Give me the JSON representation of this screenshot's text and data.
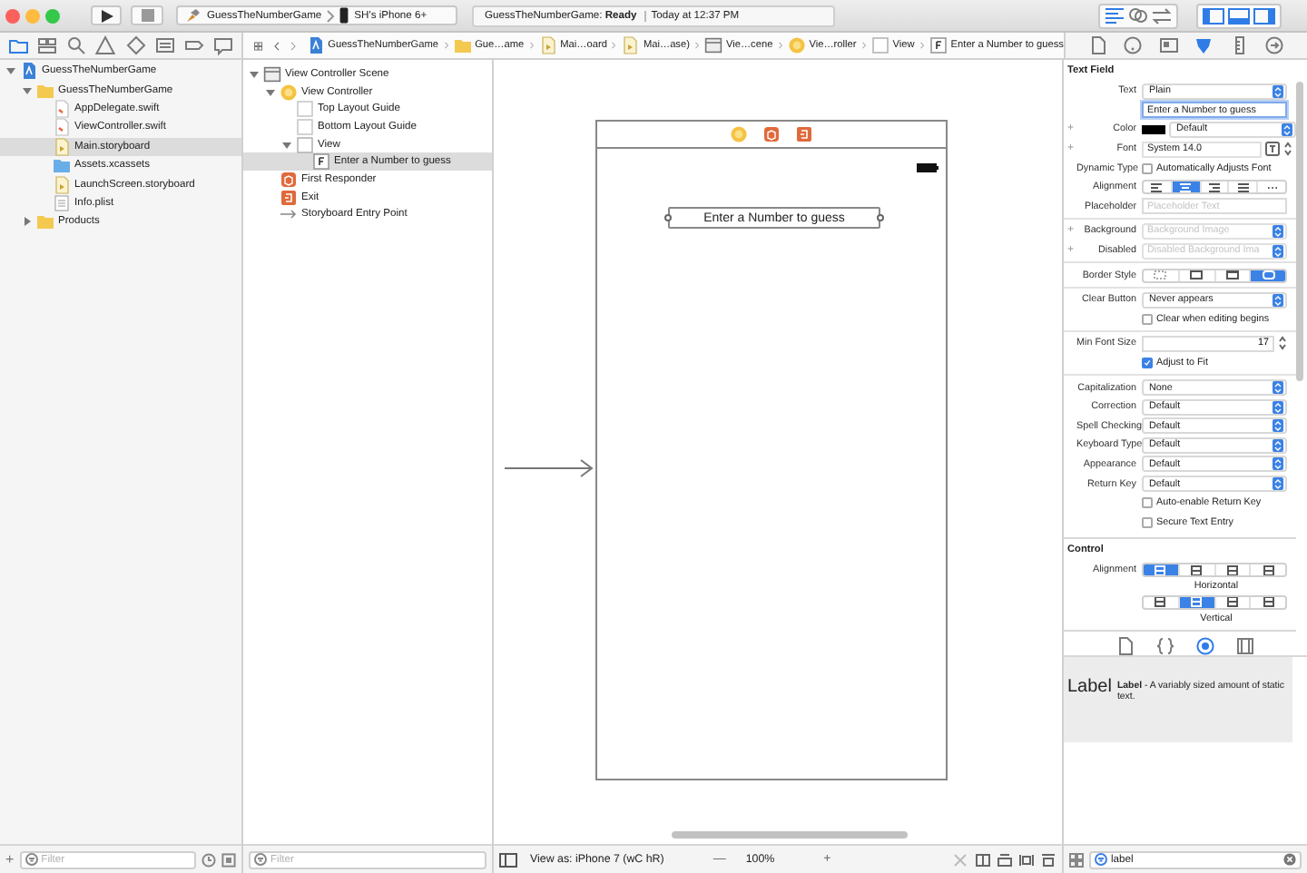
{
  "window": {
    "controls": [
      {
        "color": "#fc605c"
      },
      {
        "color": "#fdbc40"
      },
      {
        "color": "#34c84a"
      }
    ]
  },
  "toolbar": {
    "scheme": "GuessTheNumberGame",
    "device": "SH's iPhone 6+",
    "activity": "GuessTheNumberGame: **Ready**",
    "time": "Today at 12:37 PM",
    "editor_modes": [
      {
        "kind": "standard",
        "selected": true
      },
      {
        "kind": "assistant",
        "selected": false
      },
      {
        "kind": "version",
        "selected": false
      }
    ],
    "panels": [
      {
        "kind": "navigator",
        "on": true
      },
      {
        "kind": "debug",
        "on": true
      },
      {
        "kind": "utilities",
        "on": true
      }
    ]
  },
  "navigator": {
    "tabs": [
      {
        "kind": "folder",
        "selected": true
      },
      {
        "kind": "hierarchy",
        "selected": false
      },
      {
        "kind": "search",
        "selected": false
      },
      {
        "kind": "warning",
        "selected": false
      },
      {
        "kind": "test",
        "selected": false
      },
      {
        "kind": "debug",
        "selected": false
      },
      {
        "kind": "breakpoint",
        "selected": false
      },
      {
        "kind": "report",
        "selected": false
      }
    ],
    "tree": [
      {
        "label": "GuessTheNumberGame",
        "kind": "project",
        "expanded": true,
        "selected": false,
        "children": [
          {
            "label": "GuessTheNumberGame",
            "kind": "folder",
            "expanded": true,
            "selected": false,
            "children": [
              {
                "label": "AppDelegate.swift",
                "kind": "swift",
                "selected": false
              },
              {
                "label": "ViewController.swift",
                "kind": "swift",
                "selected": false
              },
              {
                "label": "Main.storyboard",
                "kind": "storyboard",
                "selected": true
              },
              {
                "label": "Assets.xcassets",
                "kind": "assets",
                "selected": false
              },
              {
                "label": "LaunchScreen.storyboard",
                "kind": "storyboard",
                "selected": false
              },
              {
                "label": "Info.plist",
                "kind": "plist",
                "selected": false
              }
            ]
          },
          {
            "label": "Products",
            "kind": "folder",
            "expanded": false,
            "selected": false
          }
        ]
      }
    ],
    "add": "+",
    "filter": {
      "placeholder": "Filter"
    }
  },
  "jump_bar": {
    "crumbs": [
      {
        "label": "GuessTheNumberGame",
        "kind": "project"
      },
      {
        "label": "Gue…ame",
        "kind": "folder"
      },
      {
        "label": "Mai…oard",
        "kind": "storyboard"
      },
      {
        "label": "Mai…ase)",
        "kind": "storyboard"
      },
      {
        "label": "Vie…cene",
        "kind": "scene"
      },
      {
        "label": "Vie…roller",
        "kind": "controller"
      },
      {
        "label": "View",
        "kind": "view"
      },
      {
        "label": "Enter a Number to guess",
        "kind": "textfield"
      }
    ]
  },
  "outline": {
    "tree": [
      {
        "label": "View Controller Scene",
        "kind": "scene",
        "expanded": true,
        "selected": false,
        "children": [
          {
            "label": "View Controller",
            "kind": "controller",
            "expanded": true,
            "selected": false,
            "children": [
              {
                "label": "Top Layout Guide",
                "kind": "guide",
                "selected": false
              },
              {
                "label": "Bottom Layout Guide",
                "kind": "guide",
                "selected": false
              },
              {
                "label": "View",
                "kind": "view",
                "expanded": true,
                "selected": false,
                "children": [
                  {
                    "label": "Enter a Number to guess",
                    "kind": "textfield",
                    "selected": true
                  }
                ]
              }
            ]
          },
          {
            "label": "First Responder",
            "kind": "responder",
            "selected": false
          },
          {
            "label": "Exit",
            "kind": "exit",
            "selected": false
          },
          {
            "label": "Storyboard Entry Point",
            "kind": "entry",
            "selected": false
          }
        ]
      }
    ],
    "filter": {
      "placeholder": "Filter"
    }
  },
  "canvas": {
    "text_field": "Enter a Number to guess",
    "view_as": "View as: iPhone 7 (wC hR)",
    "zoom_out": "—",
    "zoom": "100%",
    "zoom_in": "+"
  },
  "inspector": {
    "tabs": [
      {
        "kind": "file",
        "selected": false
      },
      {
        "kind": "help",
        "selected": false
      },
      {
        "kind": "identity",
        "selected": false
      },
      {
        "kind": "attributes",
        "selected": true
      },
      {
        "kind": "size",
        "selected": false
      },
      {
        "kind": "connections",
        "selected": false
      }
    ],
    "sections": [
      {
        "title": "Text Field",
        "groups": [
          [
            {
              "kind": "popup",
              "label": "Text",
              "value": "Plain"
            },
            {
              "kind": "field",
              "value": "Enter a Number to guess",
              "focused": true
            },
            {
              "kind": "color",
              "label": "Color",
              "variation": "+",
              "color": "#000000",
              "value": "Default"
            },
            {
              "kind": "font",
              "label": "Font",
              "variation": "+",
              "value": "System 14.0"
            },
            {
              "kind": "checkbox",
              "label": "Dynamic Type",
              "text": "Automatically Adjusts Font",
              "checked": false
            },
            {
              "kind": "segments",
              "label": "Alignment",
              "segments": [
                {
                  "kind": "left",
                  "selected": false
                },
                {
                  "kind": "center",
                  "selected": true
                },
                {
                  "kind": "right",
                  "selected": false
                },
                {
                  "kind": "justified",
                  "selected": false
                },
                {
                  "kind": "natural",
                  "selected": false
                }
              ]
            },
            {
              "kind": "field",
              "label": "Placeholder",
              "placeholder": "Placeholder Text"
            }
          ],
          [
            {
              "kind": "combo",
              "label": "Background",
              "variation": "+",
              "placeholder": "Background Image"
            },
            {
              "kind": "combo",
              "label": "Disabled",
              "variation": "+",
              "placeholder": "Disabled Background Ima"
            }
          ],
          [
            {
              "kind": "segments",
              "label": "Border Style",
              "segments": [
                {
                  "kind": "none",
                  "selected": false
                },
                {
                  "kind": "line",
                  "selected": false
                },
                {
                  "kind": "bezel",
                  "selected": false
                },
                {
                  "kind": "rounded",
                  "selected": true
                }
              ]
            }
          ],
          [
            {
              "kind": "popup",
              "label": "Clear Button",
              "value": "Never appears"
            },
            {
              "kind": "checkbox",
              "text": "Clear when editing begins",
              "checked": false
            }
          ],
          [
            {
              "kind": "stepper",
              "label": "Min Font Size",
              "value": "17"
            },
            {
              "kind": "checkbox",
              "text": "Adjust to Fit",
              "checked": true
            }
          ],
          [
            {
              "kind": "popup",
              "label": "Capitalization",
              "value": "None"
            },
            {
              "kind": "popup",
              "label": "Correction",
              "value": "Default"
            },
            {
              "kind": "popup",
              "label": "Spell Checking",
              "value": "Default"
            },
            {
              "kind": "popup",
              "label": "Keyboard Type",
              "value": "Default"
            },
            {
              "kind": "popup",
              "label": "Appearance",
              "value": "Default"
            },
            {
              "kind": "popup",
              "label": "Return Key",
              "value": "Default"
            },
            {
              "kind": "checkbox",
              "text": "Auto-enable Return Key",
              "checked": false
            },
            {
              "kind": "checkbox",
              "text": "Secure Text Entry",
              "checked": false
            }
          ]
        ]
      },
      {
        "title": "Control",
        "groups": [
          [
            {
              "kind": "segments",
              "label": "Alignment",
              "caption": "Horizontal",
              "segments": [
                {
                  "kind": "frame",
                  "selected": true
                },
                {
                  "kind": "frame",
                  "selected": false
                },
                {
                  "kind": "frame",
                  "selected": false
                },
                {
                  "kind": "frame",
                  "selected": false
                }
              ]
            },
            {
              "kind": "segments",
              "caption": "Vertical",
              "segments": [
                {
                  "kind": "frame",
                  "selected": false
                },
                {
                  "kind": "frame",
                  "selected": true
                },
                {
                  "kind": "frame",
                  "selected": false
                },
                {
                  "kind": "frame",
                  "selected": false
                }
              ]
            }
          ]
        ]
      }
    ],
    "library": {
      "tabs": [
        {
          "kind": "file",
          "selected": false
        },
        {
          "kind": "code",
          "selected": false
        },
        {
          "kind": "object",
          "selected": true
        },
        {
          "kind": "media",
          "selected": false
        }
      ],
      "items": [
        {
          "preview": "Label",
          "description": "**Label** - A variably sized amount of static text."
        }
      ],
      "search": {
        "value": "label"
      }
    }
  }
}
